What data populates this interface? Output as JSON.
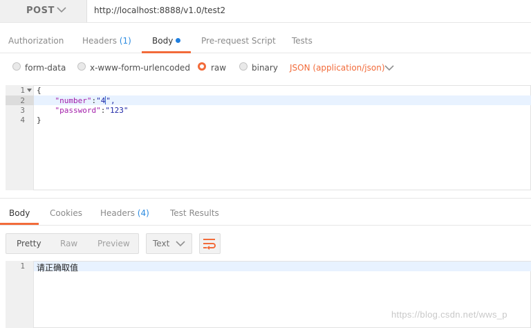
{
  "request": {
    "method": "POST",
    "url": "http://localhost:8888/v1.0/test2"
  },
  "request_tabs": [
    {
      "label": "Authorization",
      "count": "",
      "active": false
    },
    {
      "label": "Headers",
      "count": "(1)",
      "active": false
    },
    {
      "label": "Body",
      "count": "",
      "active": true
    },
    {
      "label": "Pre-request Script",
      "count": "",
      "active": false
    },
    {
      "label": "Tests",
      "count": "",
      "active": false
    }
  ],
  "body_types": {
    "options": [
      "form-data",
      "x-www-form-urlencoded",
      "raw",
      "binary"
    ],
    "selected": "raw",
    "content_type": "JSON (application/json)"
  },
  "request_body": {
    "line_numbers": [
      "1",
      "2",
      "3",
      "4"
    ],
    "lines": [
      "{",
      "\"number\":\"4\",",
      "\"password\":\"123\"",
      "}"
    ],
    "key_number": "\"number\"",
    "val_number_a": "\"4",
    "val_number_b": "\",",
    "key_password": "\"password\"",
    "val_password": "\"123\"",
    "colon": ":",
    "open_brace": "{",
    "close_brace": "}"
  },
  "response_tabs": [
    {
      "label": "Body",
      "count": "",
      "active": true
    },
    {
      "label": "Cookies",
      "count": "",
      "active": false
    },
    {
      "label": "Headers",
      "count": "(4)",
      "active": false
    },
    {
      "label": "Test Results",
      "count": "",
      "active": false
    }
  ],
  "response_view": {
    "modes": [
      "Pretty",
      "Raw",
      "Preview"
    ],
    "active_mode": "Pretty",
    "format": "Text"
  },
  "response_body": {
    "line_number": "1",
    "text": "请正确取值"
  },
  "watermark": "https://blog.csdn.net/wws_p",
  "colors": {
    "accent": "#f26b3a",
    "count_blue": "#2c8be0",
    "dot_blue": "#1f7fe0",
    "json_key": "#a31daa",
    "json_string": "#1d26a6"
  }
}
